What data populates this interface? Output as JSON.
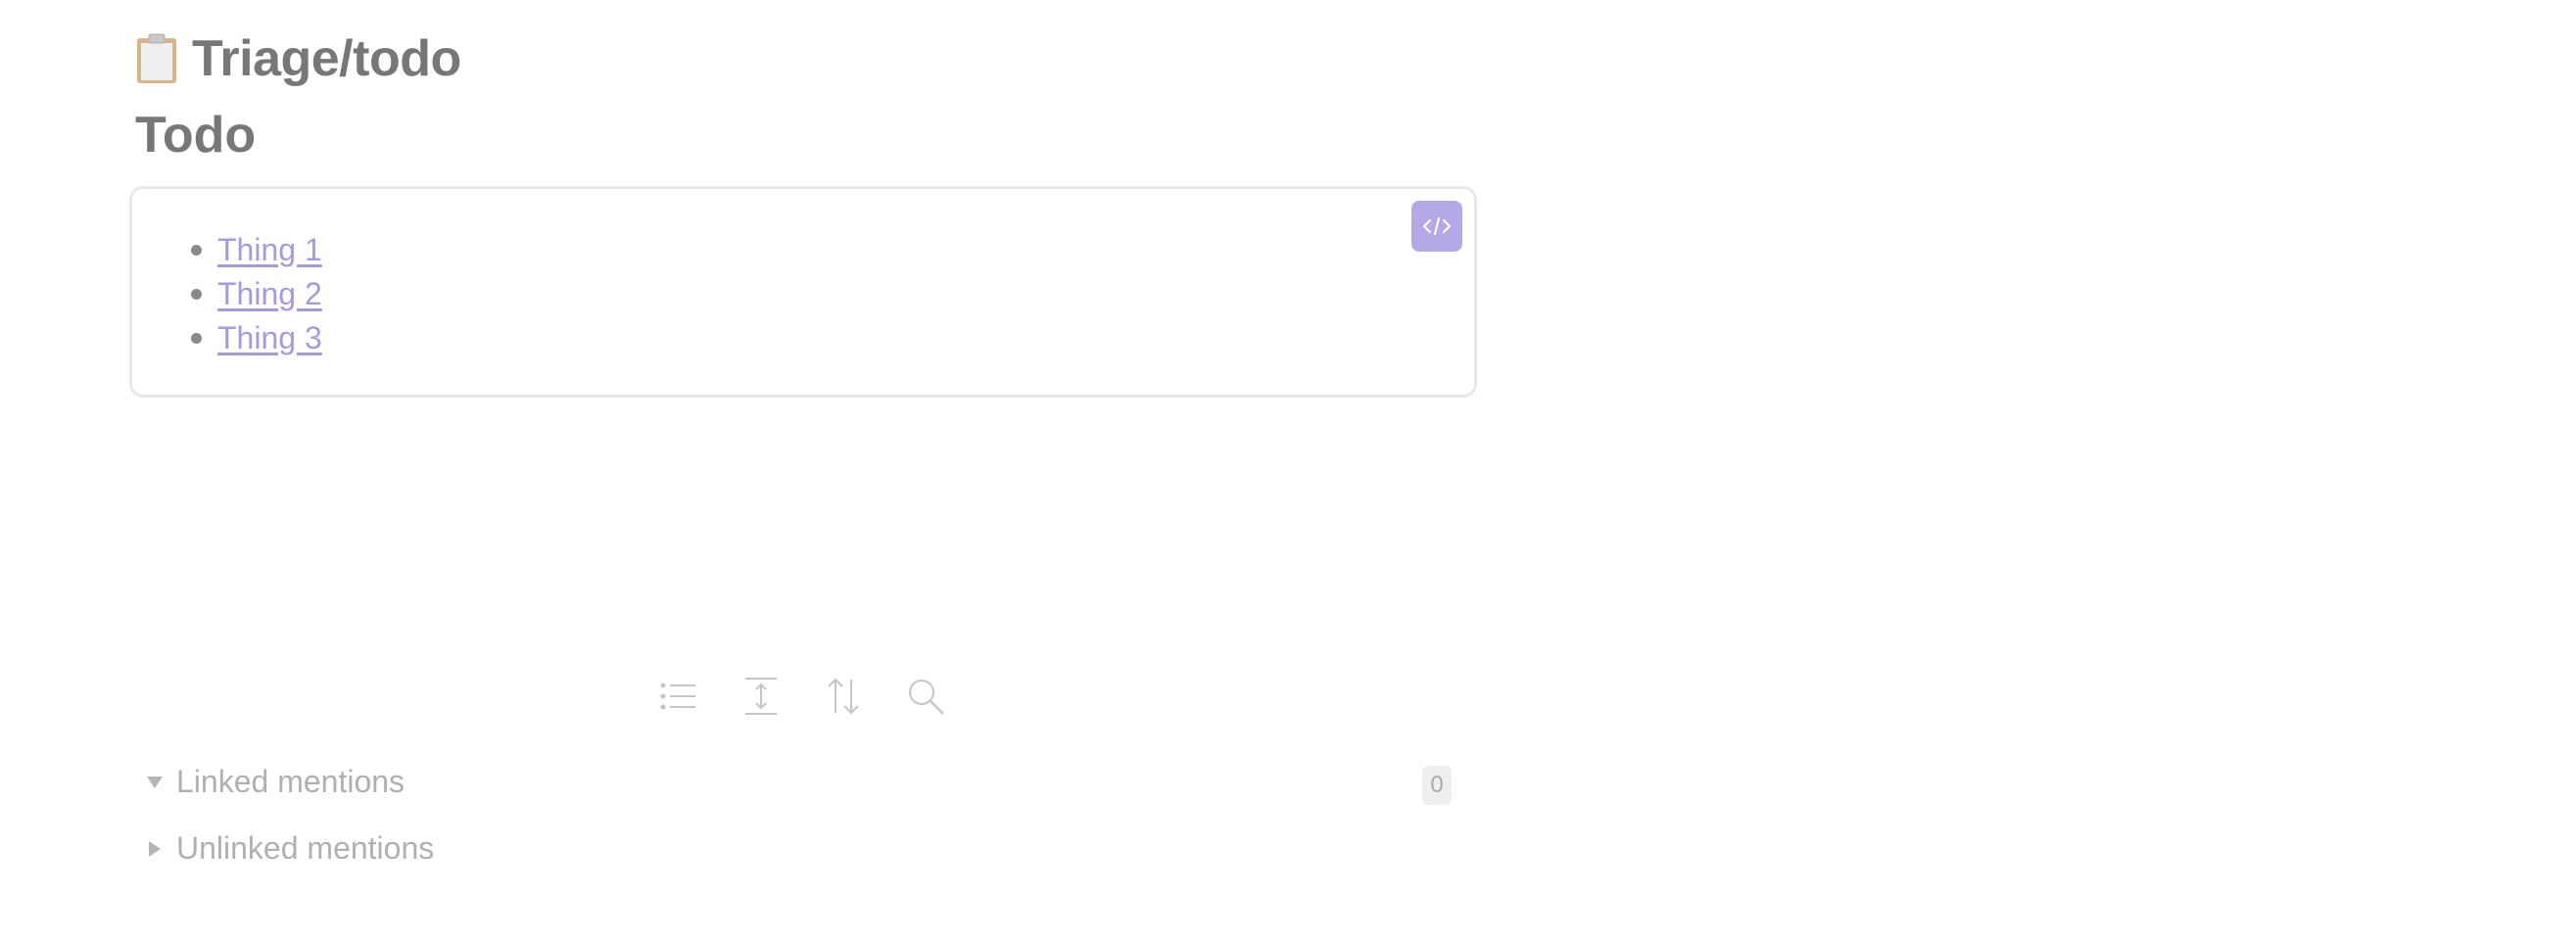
{
  "page": {
    "title": "Triage/todo",
    "title_icon": "clipboard-icon"
  },
  "section": {
    "heading": "Todo"
  },
  "embed": {
    "code_button_icon": "code-icon",
    "items": [
      {
        "label": "Thing 1"
      },
      {
        "label": "Thing 2"
      },
      {
        "label": "Thing 3"
      }
    ]
  },
  "toolbar": {
    "icons": [
      "list-icon",
      "expand-height-icon",
      "sort-icon",
      "search-icon"
    ]
  },
  "mentions": {
    "linked_label": "Linked mentions",
    "linked_count": "0",
    "unlinked_label": "Unlinked mentions"
  },
  "colors": {
    "accent": "#a899dd",
    "code_button": "#b4a8e6",
    "text": "#777777",
    "muted": "#b0b0b0"
  }
}
